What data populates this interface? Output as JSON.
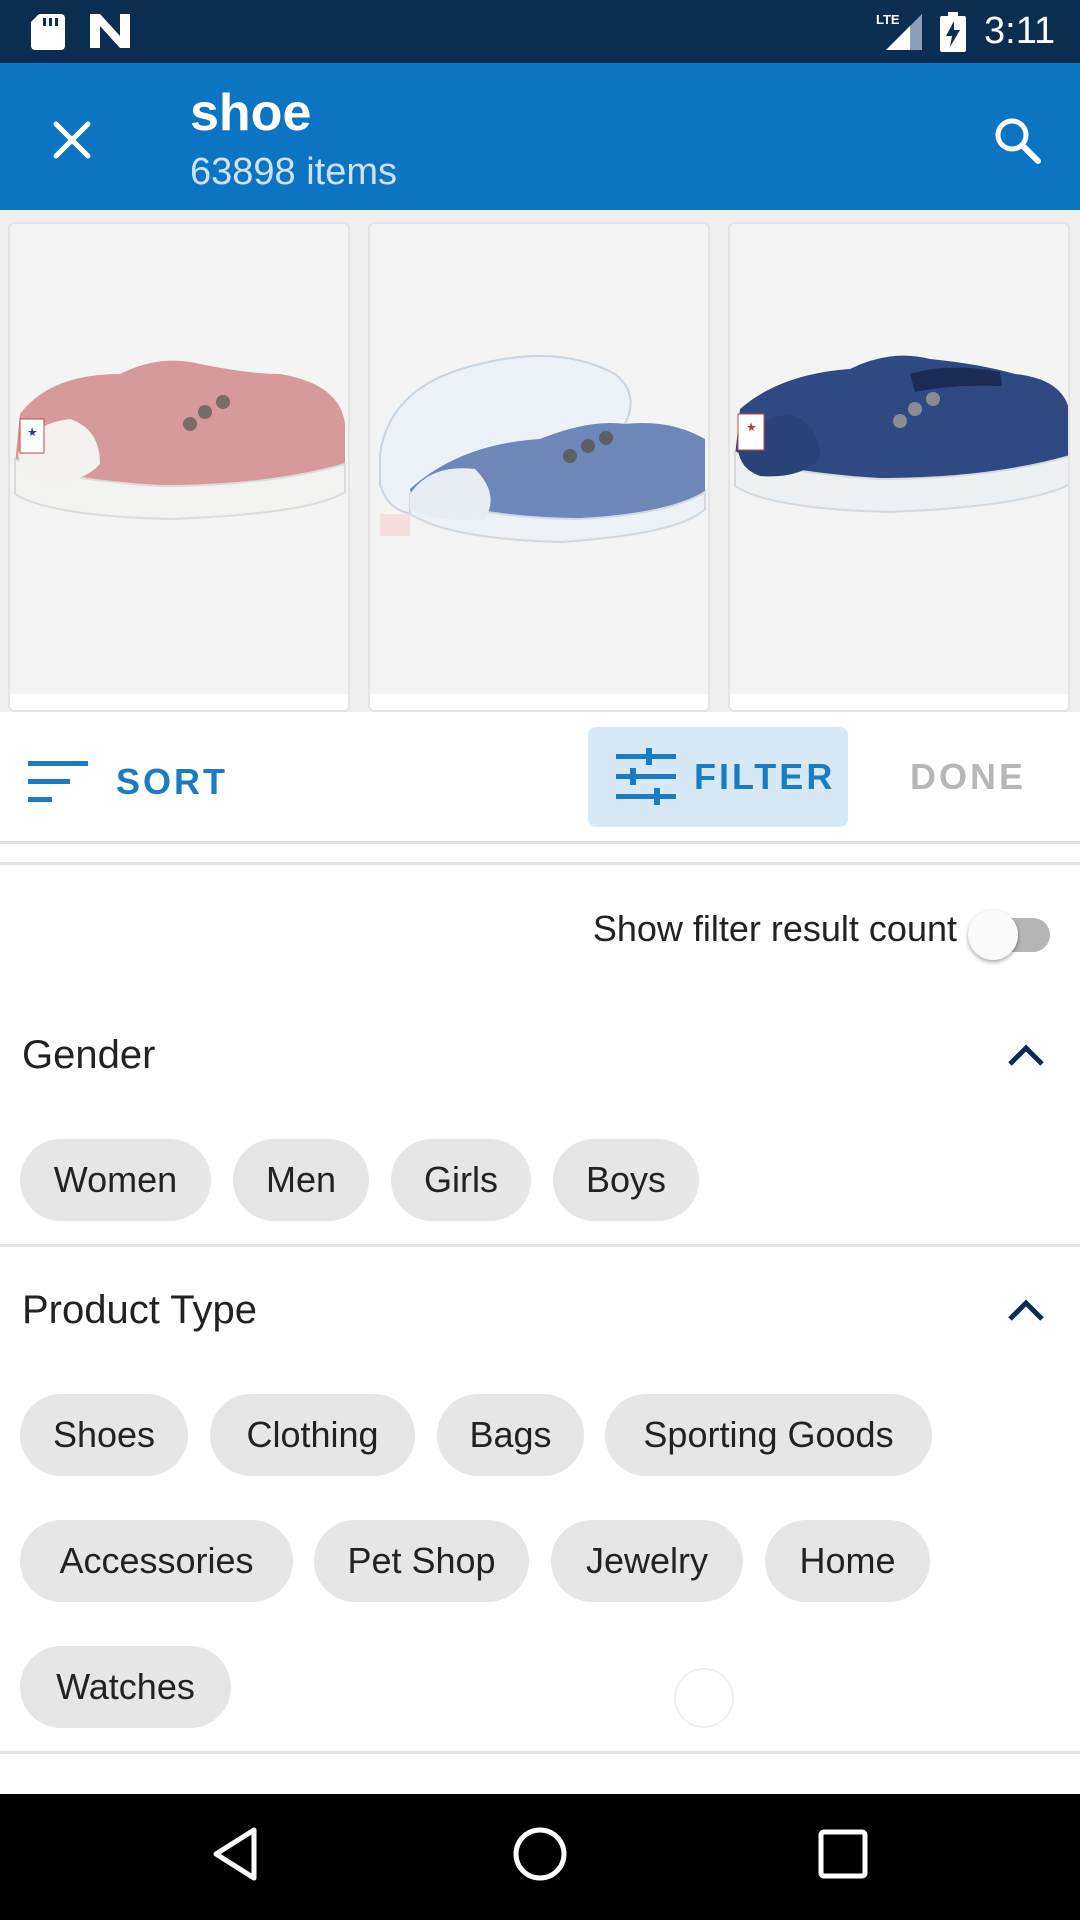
{
  "status_bar": {
    "time": "3:11",
    "network": "LTE",
    "icons": [
      "sd-card-icon",
      "n-notification-icon",
      "lte-signal-icon",
      "battery-charging-icon"
    ]
  },
  "app_bar": {
    "title": "shoe",
    "subtitle": "63898 items",
    "close_icon": "close-icon",
    "search_icon": "search-icon"
  },
  "products": [
    {
      "name": "pink slip-on canvas sneaker",
      "color": "#d79a9c"
    },
    {
      "name": "light blue slip-on canvas sneaker",
      "color": "#6e86b8"
    },
    {
      "name": "navy slip-on canvas sneaker",
      "color": "#2f4a83"
    }
  ],
  "toolbar": {
    "sort_label": "SORT",
    "filter_label": "FILTER",
    "done_label": "DONE"
  },
  "filter_count_toggle": {
    "label": "Show filter result count",
    "enabled": false
  },
  "gender": {
    "title": "Gender",
    "options": [
      "Women",
      "Men",
      "Girls",
      "Boys"
    ]
  },
  "product_type": {
    "title": "Product Type",
    "options": [
      "Shoes",
      "Clothing",
      "Bags",
      "Sporting Goods",
      "Accessories",
      "Pet Shop",
      "Jewelry",
      "Home",
      "Watches"
    ]
  },
  "colors": {
    "status_bar": "#0b2d52",
    "app_bar": "#0b74c3",
    "accent": "#1a7cc3",
    "chip_bg": "#e6e6e6"
  }
}
